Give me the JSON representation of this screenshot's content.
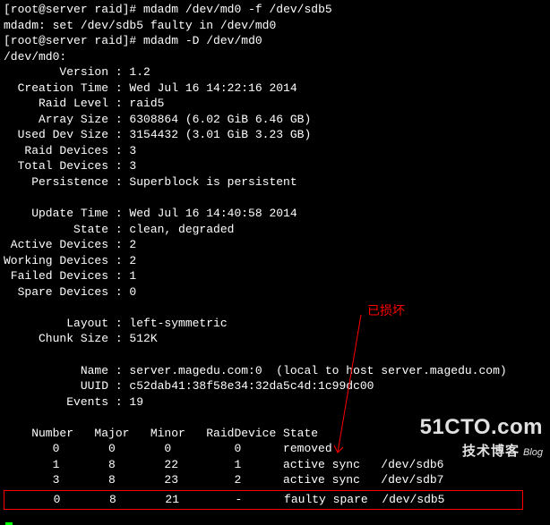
{
  "prompt": "[root@server raid]#",
  "cmd1": "mdadm /dev/md0 -f /dev/sdb5",
  "output1": "mdadm: set /dev/sdb5 faulty in /dev/md0",
  "cmd2": "mdadm -D /dev/md0",
  "device_line": "/dev/md0:",
  "kv": [
    {
      "label": "Version",
      "value": "1.2"
    },
    {
      "label": "Creation Time",
      "value": "Wed Jul 16 14:22:16 2014"
    },
    {
      "label": "Raid Level",
      "value": "raid5"
    },
    {
      "label": "Array Size",
      "value": "6308864 (6.02 GiB 6.46 GB)"
    },
    {
      "label": "Used Dev Size",
      "value": "3154432 (3.01 GiB 3.23 GB)"
    },
    {
      "label": "Raid Devices",
      "value": "3"
    },
    {
      "label": "Total Devices",
      "value": "3"
    },
    {
      "label": "Persistence",
      "value": "Superblock is persistent"
    }
  ],
  "kv2": [
    {
      "label": "Update Time",
      "value": "Wed Jul 16 14:40:58 2014"
    },
    {
      "label": "State",
      "value": "clean, degraded"
    },
    {
      "label": "Active Devices",
      "value": "2"
    },
    {
      "label": "Working Devices",
      "value": "2"
    },
    {
      "label": "Failed Devices",
      "value": "1"
    },
    {
      "label": "Spare Devices",
      "value": "0"
    }
  ],
  "kv3": [
    {
      "label": "Layout",
      "value": "left-symmetric"
    },
    {
      "label": "Chunk Size",
      "value": "512K"
    }
  ],
  "kv4": [
    {
      "label": "Name",
      "value": "server.magedu.com:0  (local to host server.magedu.com)"
    },
    {
      "label": "UUID",
      "value": "c52dab41:38f58e34:32da5c4d:1c99dc00"
    },
    {
      "label": "Events",
      "value": "19"
    }
  ],
  "table": {
    "headers": [
      "Number",
      "Major",
      "Minor",
      "RaidDevice",
      "State"
    ],
    "rows": [
      {
        "number": "0",
        "major": "0",
        "minor": "0",
        "raid": "0",
        "state": "removed",
        "dev": ""
      },
      {
        "number": "1",
        "major": "8",
        "minor": "22",
        "raid": "1",
        "state": "active sync",
        "dev": "/dev/sdb6"
      },
      {
        "number": "3",
        "major": "8",
        "minor": "23",
        "raid": "2",
        "state": "active sync",
        "dev": "/dev/sdb7"
      }
    ],
    "faulty": {
      "number": "0",
      "major": "8",
      "minor": "21",
      "raid": "-",
      "state": "faulty spare",
      "dev": "/dev/sdb5"
    }
  },
  "annotation": "已损坏",
  "watermark": {
    "main": "51CTO.com",
    "sub": "技术博客",
    "tag": "Blog"
  }
}
